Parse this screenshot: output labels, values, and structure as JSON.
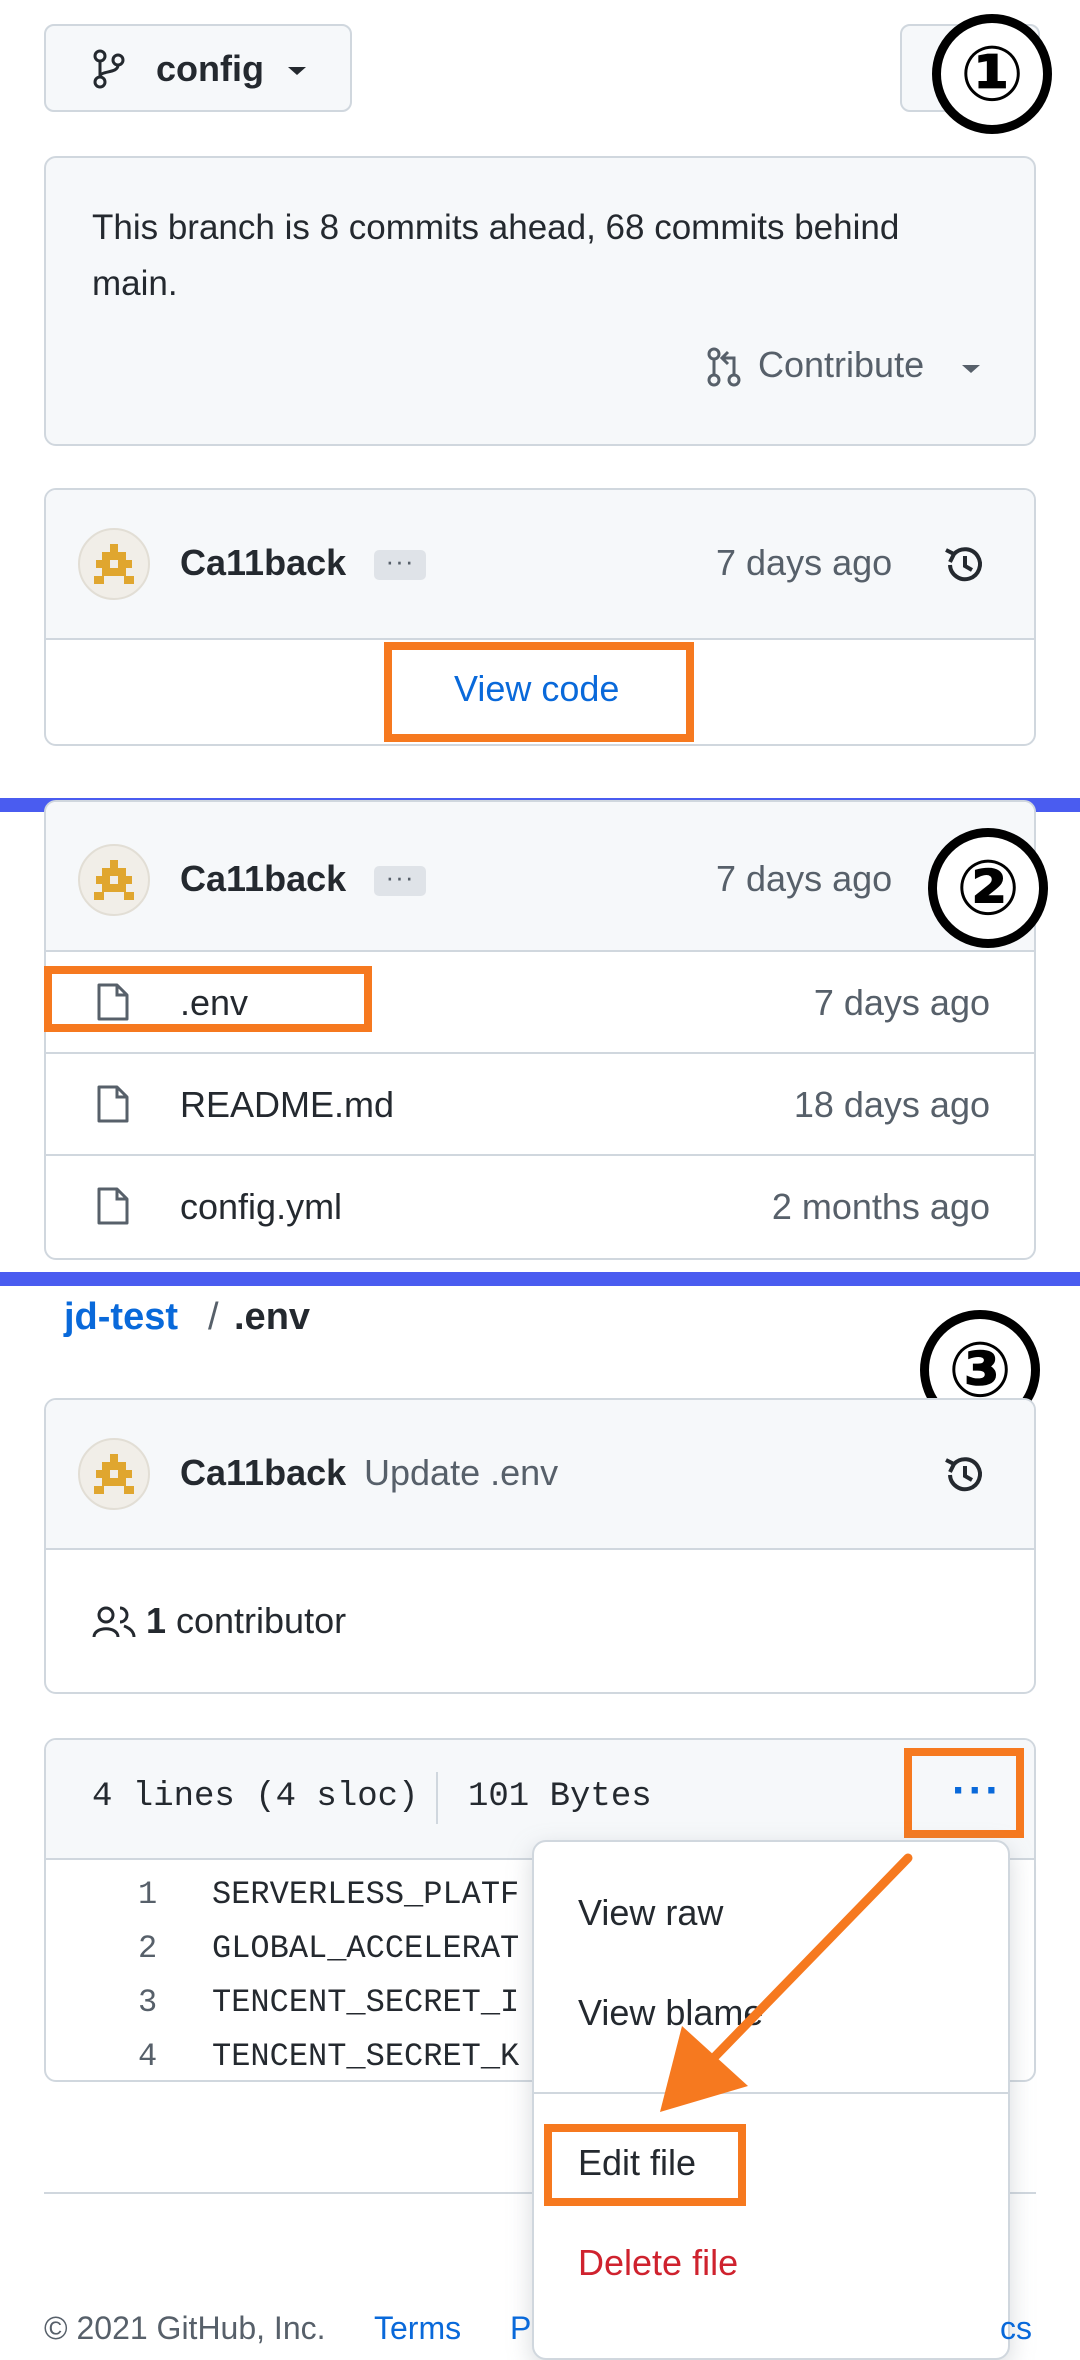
{
  "step_markers": [
    "①",
    "②",
    "③"
  ],
  "section1": {
    "branch_label": "config",
    "more_button": "···",
    "branch_status": "This branch is 8 commits ahead, 68 commits behind main.",
    "branch_status_line1": "This branch is 8 commits ahead, 68 commits behind",
    "branch_status_line2": "main.",
    "contribute_label": "Contribute",
    "commit": {
      "author": "Ca11back",
      "ellipsis": "···",
      "time": "7 days ago"
    },
    "view_code_label": "View code"
  },
  "section2": {
    "commit": {
      "author": "Ca11back",
      "ellipsis": "···",
      "time": "7 days ago"
    },
    "files": [
      {
        "name": ".env",
        "time": "7 days ago"
      },
      {
        "name": "README.md",
        "time": "18 days ago"
      },
      {
        "name": "config.yml",
        "time": "2 months ago"
      }
    ]
  },
  "section3": {
    "breadcrumb": {
      "repo": "jd-test",
      "separator": "/",
      "file": ".env"
    },
    "commit": {
      "author": "Ca11back",
      "message": "Update .env"
    },
    "contributors": {
      "count": "1",
      "label": "contributor"
    },
    "file_info": {
      "lines": "4 lines (4 sloc)",
      "size": "101 Bytes"
    },
    "kebab": "···",
    "code_lines": [
      {
        "num": "1",
        "text": "SERVERLESS_PLATF"
      },
      {
        "num": "2",
        "text": "GLOBAL_ACCELERAT"
      },
      {
        "num": "3",
        "text": "TENCENT_SECRET_I"
      },
      {
        "num": "4",
        "text": "TENCENT_SECRET_K"
      }
    ],
    "menu": {
      "view_raw": "View raw",
      "view_blame": "View blame",
      "edit_file": "Edit file",
      "delete_file": "Delete file"
    }
  },
  "footer": {
    "copyright": "© 2021 GitHub, Inc.",
    "terms": "Terms",
    "privacy": "P",
    "trailing": "cs"
  },
  "colors": {
    "annotation_orange": "#f6791f",
    "divider_blue": "#4a5cf0",
    "link_blue": "#0969da",
    "danger_red": "#cf222e"
  }
}
